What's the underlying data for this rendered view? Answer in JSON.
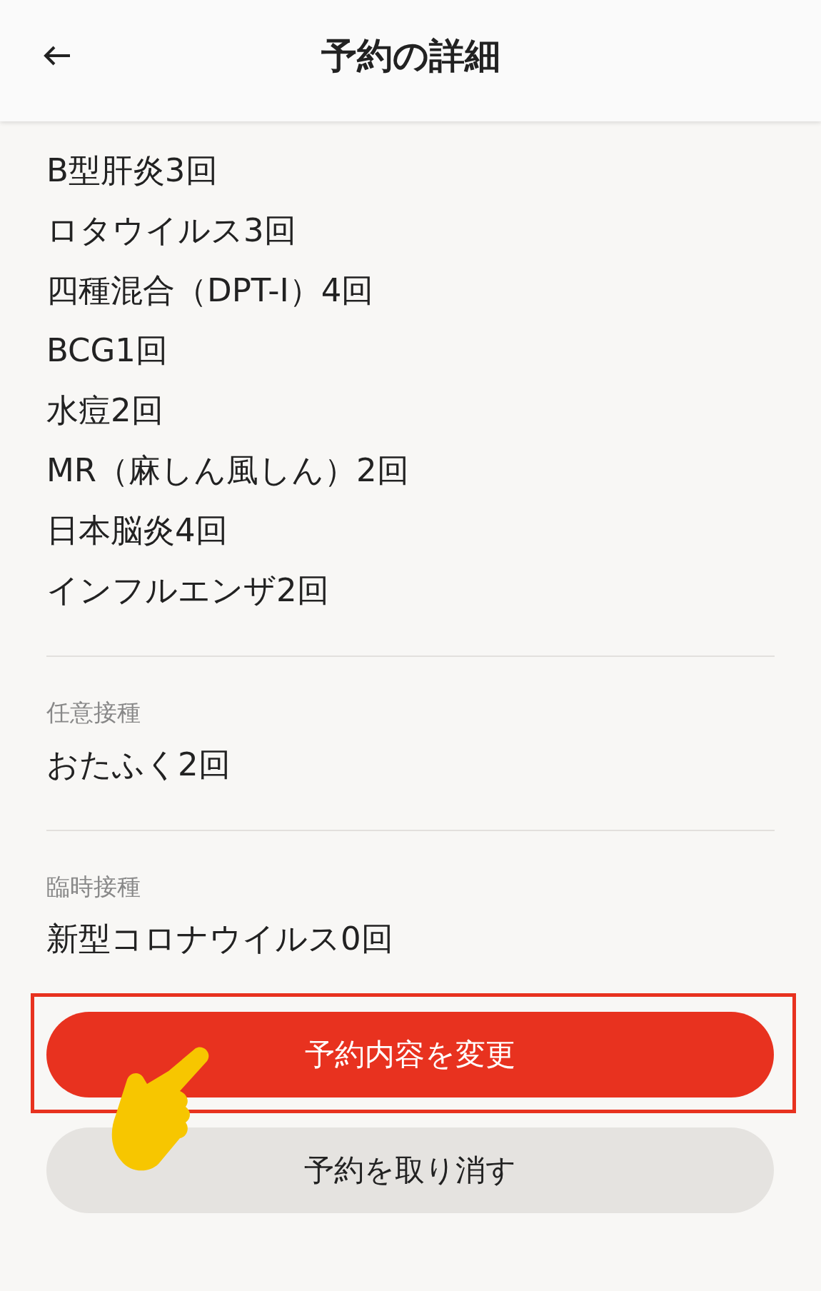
{
  "header": {
    "title": "予約の詳細"
  },
  "sections": [
    {
      "items": [
        "B型肝炎3回",
        "ロタウイルス3回",
        "四種混合（DPT-I）4回",
        "BCG1回",
        "水痘2回",
        "MR（麻しん風しん）2回",
        "日本脳炎4回",
        "インフルエンザ2回"
      ]
    },
    {
      "label": "任意接種",
      "items": [
        "おたふく2回"
      ]
    },
    {
      "label": "臨時接種",
      "items": [
        "新型コロナウイルス0回"
      ]
    }
  ],
  "buttons": [
    {
      "label": "予約内容を変更",
      "kind": "primary",
      "highlighted": true
    },
    {
      "label": "予約を取り消す",
      "kind": "secondary",
      "highlighted": false
    }
  ]
}
